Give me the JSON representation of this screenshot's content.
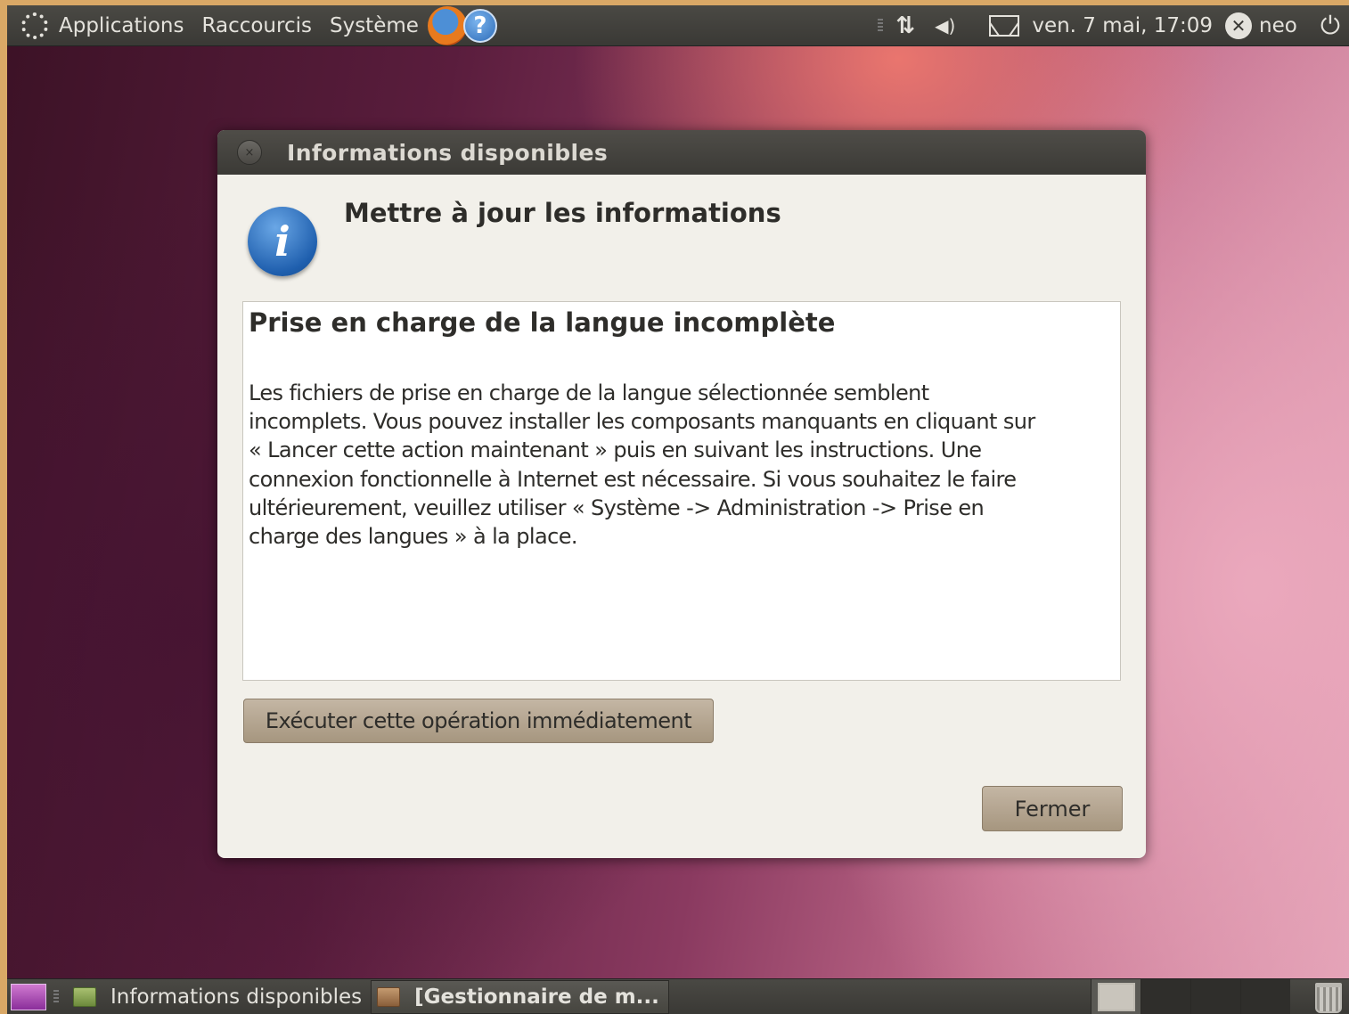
{
  "top_panel": {
    "menus": [
      "Applications",
      "Raccourcis",
      "Système"
    ],
    "help_glyph": "?",
    "network_glyph": "⇅",
    "volume_glyph": "◀)",
    "clock": "ven.  7 mai, 17:09",
    "status_glyph": "✕",
    "username": "neo",
    "power_glyph": "⏻",
    "icons": [
      "ubuntu-logo-icon",
      "firefox-icon",
      "help-icon",
      "network-icon",
      "volume-icon",
      "mail-icon",
      "user-status-icon",
      "power-icon"
    ]
  },
  "dialog": {
    "title": "Informations disponibles",
    "close_glyph": "×",
    "info_glyph": "i",
    "heading": "Mettre à jour les informations",
    "content_title": "Prise en charge de la langue incomplète",
    "content_lines": [
      "Les fichiers de prise en charge de la langue sélectionnée semblent",
      "incomplets. Vous pouvez installer les composants manquants en cliquant sur",
      "« Lancer cette action maintenant » puis en suivant les instructions. Une",
      "connexion fonctionnelle à Internet est nécessaire. Si vous souhaitez le faire",
      "ultérieurement, veuillez utiliser « Système -> Administration -> Prise en",
      "charge des langues » à la place."
    ],
    "run_button": "Exécuter cette opération immédiatement",
    "close_button": "Fermer"
  },
  "bottom_panel": {
    "tasks": [
      {
        "label": "Informations disponibles",
        "active": false
      },
      {
        "label": "[Gestionnaire de m...",
        "active": true
      }
    ],
    "workspaces": 4
  },
  "colors": {
    "panel": "#3a3935",
    "dialog_bg": "#f2f0ea",
    "button": "#b5a690",
    "titlebar": "#45433f"
  }
}
